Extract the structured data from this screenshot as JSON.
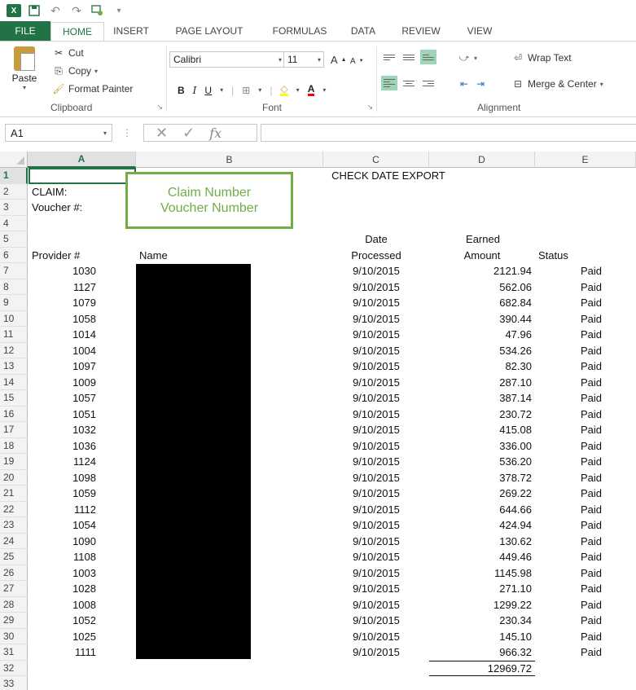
{
  "app": {
    "logo_text": "X",
    "qat_icons": [
      "excel-logo",
      "save-icon",
      "undo-icon",
      "redo-icon",
      "touch-mode-icon",
      "customize-icon"
    ],
    "brand_color": "#217346"
  },
  "tabs": [
    {
      "label": "FILE"
    },
    {
      "label": "HOME"
    },
    {
      "label": "INSERT"
    },
    {
      "label": "PAGE LAYOUT"
    },
    {
      "label": "FORMULAS"
    },
    {
      "label": "DATA"
    },
    {
      "label": "REVIEW"
    },
    {
      "label": "VIEW"
    }
  ],
  "ribbon": {
    "clipboard": {
      "paste_label": "Paste",
      "cut_label": "Cut",
      "copy_label": "Copy",
      "format_painter_label": "Format Painter",
      "group_label": "Clipboard"
    },
    "font": {
      "font_name": "Calibri",
      "font_size": "11",
      "bold": "B",
      "italic": "I",
      "underline": "U",
      "grow": "A",
      "shrink": "A",
      "fill_letter": "A",
      "group_label": "Font"
    },
    "alignment": {
      "wrap_text_label": "Wrap Text",
      "merge_center_label": "Merge & Center",
      "group_label": "Alignment"
    }
  },
  "formula_bar": {
    "name_box": "A1",
    "fx_label": "fx",
    "formula": ""
  },
  "columns": [
    "A",
    "B",
    "C",
    "D",
    "E"
  ],
  "sheet": {
    "title": "CHECK DATE EXPORT",
    "claim_label": "CLAIM:",
    "voucher_label": "Voucher #:",
    "headers": {
      "provider": "Provider #",
      "name": "Name",
      "date_top": "Date",
      "date_bottom": "Processed",
      "earned_top": "Earned",
      "earned_bottom": "Amount",
      "status": "Status"
    },
    "rows": [
      {
        "provider": "1030",
        "date": "9/10/2015",
        "amount": "2121.94",
        "status": "Paid"
      },
      {
        "provider": "1127",
        "date": "9/10/2015",
        "amount": "562.06",
        "status": "Paid"
      },
      {
        "provider": "1079",
        "date": "9/10/2015",
        "amount": "682.84",
        "status": "Paid"
      },
      {
        "provider": "1058",
        "date": "9/10/2015",
        "amount": "390.44",
        "status": "Paid"
      },
      {
        "provider": "1014",
        "date": "9/10/2015",
        "amount": "47.96",
        "status": "Paid"
      },
      {
        "provider": "1004",
        "date": "9/10/2015",
        "amount": "534.26",
        "status": "Paid"
      },
      {
        "provider": "1097",
        "date": "9/10/2015",
        "amount": "82.30",
        "status": "Paid"
      },
      {
        "provider": "1009",
        "date": "9/10/2015",
        "amount": "287.10",
        "status": "Paid"
      },
      {
        "provider": "1057",
        "date": "9/10/2015",
        "amount": "387.14",
        "status": "Paid"
      },
      {
        "provider": "1051",
        "date": "9/10/2015",
        "amount": "230.72",
        "status": "Paid"
      },
      {
        "provider": "1032",
        "date": "9/10/2015",
        "amount": "415.08",
        "status": "Paid"
      },
      {
        "provider": "1036",
        "date": "9/10/2015",
        "amount": "336.00",
        "status": "Paid"
      },
      {
        "provider": "1124",
        "date": "9/10/2015",
        "amount": "536.20",
        "status": "Paid"
      },
      {
        "provider": "1098",
        "date": "9/10/2015",
        "amount": "378.72",
        "status": "Paid"
      },
      {
        "provider": "1059",
        "date": "9/10/2015",
        "amount": "269.22",
        "status": "Paid"
      },
      {
        "provider": "1112",
        "date": "9/10/2015",
        "amount": "644.66",
        "status": "Paid"
      },
      {
        "provider": "1054",
        "date": "9/10/2015",
        "amount": "424.94",
        "status": "Paid"
      },
      {
        "provider": "1090",
        "date": "9/10/2015",
        "amount": "130.62",
        "status": "Paid"
      },
      {
        "provider": "1108",
        "date": "9/10/2015",
        "amount": "449.46",
        "status": "Paid"
      },
      {
        "provider": "1003",
        "date": "9/10/2015",
        "amount": "1145.98",
        "status": "Paid"
      },
      {
        "provider": "1028",
        "date": "9/10/2015",
        "amount": "271.10",
        "status": "Paid"
      },
      {
        "provider": "1008",
        "date": "9/10/2015",
        "amount": "1299.22",
        "status": "Paid"
      },
      {
        "provider": "1052",
        "date": "9/10/2015",
        "amount": "230.34",
        "status": "Paid"
      },
      {
        "provider": "1025",
        "date": "9/10/2015",
        "amount": "145.10",
        "status": "Paid"
      },
      {
        "provider": "1111",
        "date": "9/10/2015",
        "amount": "966.32",
        "status": "Paid"
      }
    ],
    "total": "12969.72",
    "row_numbers": [
      "1",
      "2",
      "3",
      "4",
      "5",
      "6",
      "7",
      "8",
      "9",
      "10",
      "11",
      "12",
      "13",
      "14",
      "15",
      "16",
      "17",
      "18",
      "19",
      "20",
      "21",
      "22",
      "23",
      "24",
      "25",
      "26",
      "27",
      "28",
      "29",
      "30",
      "31",
      "32",
      "33"
    ]
  },
  "callout": {
    "line1": "Claim Number",
    "line2": "Voucher Number",
    "color": "#70ad47"
  }
}
